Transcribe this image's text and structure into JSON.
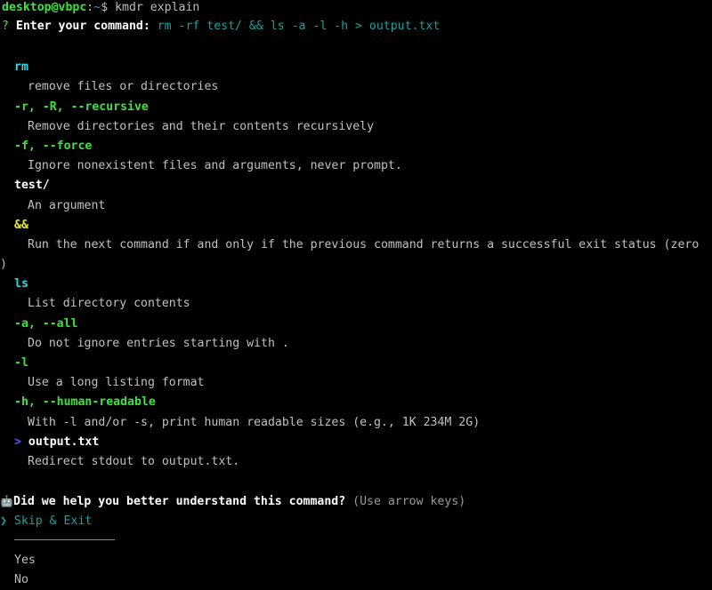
{
  "terminal": {
    "shell_prompt": {
      "user_host": "desktop@vbpc",
      "colon": ":",
      "path": "~",
      "dollar": "$",
      "typed_command": "kmdr explain"
    },
    "query_line": {
      "marker": "?",
      "label": "Enter your command:",
      "command": "rm -rf test/ && ls -a -l -h > output.txt"
    },
    "explanation": [
      {
        "token": "rm",
        "token_style": "cyan-bold",
        "description": "remove files or directories"
      },
      {
        "token": "-r, -R, --recursive",
        "token_style": "green-bold",
        "description": "Remove directories and their contents recursively"
      },
      {
        "token": "-f, --force",
        "token_style": "green-bold",
        "description": "Ignore nonexistent files and arguments, never prompt."
      },
      {
        "token": "test/",
        "token_style": "white-bold",
        "description": "An argument"
      },
      {
        "token": "&&",
        "token_style": "yellow-bold",
        "description_part1": "Run the next command if and only if the previous command returns a successful exit status (zero",
        "description_part2": ")"
      },
      {
        "token": "ls",
        "token_style": "cyan-bold",
        "description": "List directory contents"
      },
      {
        "token": "-a, --all",
        "token_style": "green-bold",
        "description": "Do not ignore entries starting with ."
      },
      {
        "token": "-l",
        "token_style": "green-bold",
        "description": "Use a long listing format"
      },
      {
        "token": "-h, --human-readable",
        "token_style": "green-bold",
        "description": "With -l and/or -s, print human readable sizes (e.g., 1K 234M 2G)"
      },
      {
        "token_prefix": ">",
        "token": "output.txt",
        "token_style": "white-bold",
        "description": "Redirect stdout to output.txt."
      }
    ],
    "survey": {
      "icon": "robot-icon",
      "icon_glyph": "🤖",
      "question": "Did we help you better understand this command?",
      "hint": "(Use arrow keys)",
      "selected_marker": "❯",
      "options": [
        {
          "label": "Skip & Exit",
          "selected": true
        },
        {
          "label": "Yes",
          "selected": false
        },
        {
          "label": "No",
          "selected": false
        }
      ]
    }
  },
  "colors": {
    "background": "#000000",
    "command_teal": "#1f9e9e",
    "flag_green": "#3ee23e",
    "program_cyan": "#2fd8e8",
    "operator_yellow": "#e8e82c",
    "redirect_blue": "#5555ff",
    "description_grey": "#c0c0c0",
    "prompt_green": "#3ee23e",
    "path_blue": "#4f7fe8"
  }
}
